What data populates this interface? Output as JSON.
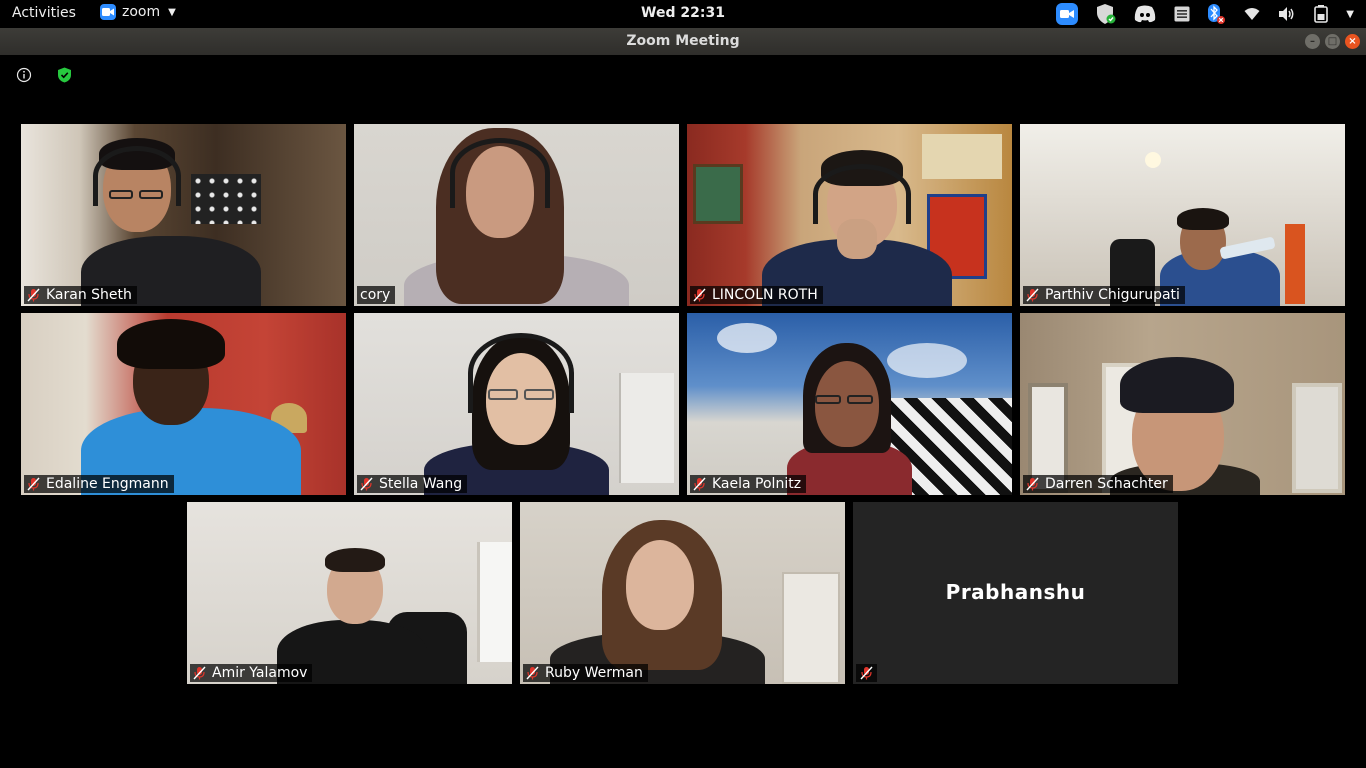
{
  "topbar": {
    "activities": "Activities",
    "app_name": "zoom",
    "clock": "Wed 22:31",
    "tray_icons": [
      "zoom-icon",
      "shield-update-icon",
      "discord-icon",
      "notes-icon",
      "bluetooth-off-icon",
      "wifi-icon",
      "volume-icon",
      "battery-icon",
      "system-menu-caret"
    ]
  },
  "window": {
    "title": "Zoom Meeting"
  },
  "meeting": {
    "participants": [
      {
        "name": "Karan Sheth",
        "muted": true,
        "active_speaker": false
      },
      {
        "name": "cory",
        "muted": false,
        "active_speaker": true
      },
      {
        "name": "LINCOLN ROTH",
        "muted": true,
        "active_speaker": false
      },
      {
        "name": "Parthiv Chigurupati",
        "muted": true,
        "active_speaker": false
      },
      {
        "name": "Edaline Engmann",
        "muted": true,
        "active_speaker": false
      },
      {
        "name": "Stella Wang",
        "muted": true,
        "active_speaker": false
      },
      {
        "name": "Kaela Polnitz",
        "muted": true,
        "active_speaker": false
      },
      {
        "name": "Darren Schachter",
        "muted": true,
        "active_speaker": false
      },
      {
        "name": "Amir Yalamov",
        "muted": true,
        "active_speaker": false
      },
      {
        "name": "Ruby Werman",
        "muted": true,
        "active_speaker": false
      },
      {
        "name": "Prabhanshu",
        "muted": true,
        "active_speaker": false,
        "video_off": true
      }
    ]
  },
  "colors": {
    "active_speaker_border": "#c9ec7a",
    "zoom_blue": "#2D8CFF",
    "mute_red": "#e0352b",
    "close_button": "#e95420"
  }
}
